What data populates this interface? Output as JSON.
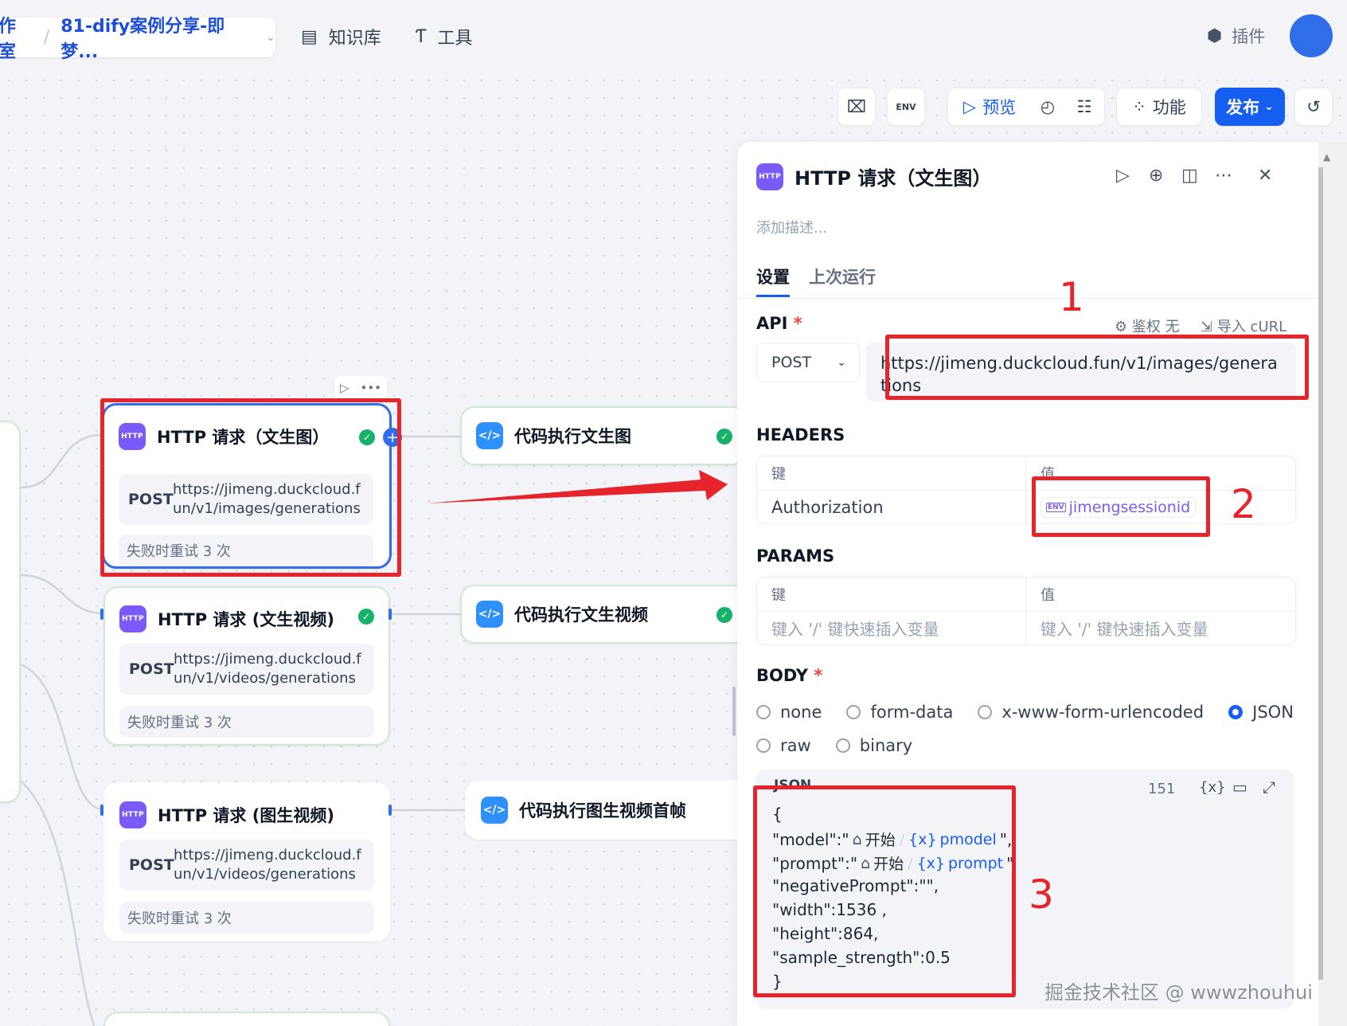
{
  "breadcrumb": {
    "workspace": "作室",
    "app_name": "81-dify案例分享-即梦..."
  },
  "nav": {
    "knowledge": "知识库",
    "tools": "工具",
    "plugins": "插件"
  },
  "toolbar": {
    "preview": "预览",
    "features": "功能",
    "publish": "发布",
    "env_label": "ENV"
  },
  "nodes": [
    {
      "type": "http",
      "title": "HTTP 请求（文生图）",
      "method": "POST",
      "url": "https://jimeng.duckcloud.fun/v1/images/generations",
      "retry": "失败时重试 3 次"
    },
    {
      "type": "http",
      "title": "HTTP 请求 (文生视频)",
      "method": "POST",
      "url": "https://jimeng.duckcloud.fun/v1/videos/generations",
      "retry": "失败时重试 3 次"
    },
    {
      "type": "http",
      "title": "HTTP 请求 (图生视频)",
      "method": "POST",
      "url": "https://jimeng.duckcloud.fun/v1/videos/generations",
      "retry": "失败时重试 3 次"
    },
    {
      "type": "code",
      "title": "代码执行文生图"
    },
    {
      "type": "code",
      "title": "代码执行文生视频"
    },
    {
      "type": "code",
      "title": "代码执行图生视频首帧"
    }
  ],
  "panel": {
    "title": "HTTP 请求（文生图）",
    "description_placeholder": "添加描述...",
    "tabs": {
      "settings": "设置",
      "last_run": "上次运行"
    },
    "api": {
      "label": "API",
      "required": "*",
      "auth": "鉴权 无",
      "import_curl": "导入 cURL",
      "method": "POST",
      "url": "https://jimeng.duckcloud.fun/v1/images/generations"
    },
    "headers": {
      "label": "HEADERS",
      "col_key": "键",
      "col_value": "值",
      "key": "Authorization",
      "value_var": "jimengsessionid"
    },
    "params": {
      "label": "PARAMS",
      "col_key": "键",
      "col_value": "值",
      "key_placeholder": "键入 '/' 键快速插入变量",
      "value_placeholder": "键入 '/' 键快速插入变量"
    },
    "body": {
      "label": "BODY",
      "required": "*",
      "options": [
        "none",
        "form-data",
        "x-www-form-urlencoded",
        "JSON",
        "raw",
        "binary"
      ],
      "selected": "JSON",
      "editor_label": "JSON",
      "char_count": "151",
      "lines": {
        "open": "{",
        "model_key": "\"model\":\"",
        "model_source": "开始",
        "model_var": "pmodel",
        "model_end": "\",",
        "prompt_key": "\"prompt\":\"",
        "prompt_source": "开始",
        "prompt_var": "prompt",
        "prompt_end": "\"",
        "negative": "\"negativePrompt\":\"\",",
        "width": "\"width\":1536 ,",
        "height": "\"height\":864,",
        "strength": "\"sample_strength\":0.5",
        "close": "}"
      }
    }
  },
  "annotations": {
    "n1": "1",
    "n2": "2",
    "n3": "3"
  },
  "watermark": "掘金技术社区 @ wwwzhouhui",
  "colors": {
    "accent": "#155eef",
    "annotation": "#e5252b",
    "http_icon": "#7a5af8",
    "code_icon": "#2e90fa",
    "success": "#17b26a"
  }
}
